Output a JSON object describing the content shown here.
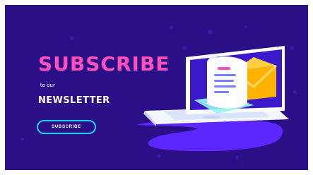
{
  "banner": {
    "title": "SUBSCRIBE",
    "subtitle": "to our",
    "heading2": "NEWSLETTER",
    "cta_label": "SUBSCRIBE",
    "colors": {
      "background": "#2a0f86",
      "title_pink": "#ff4fb8",
      "cta_cyan": "#24d3ff",
      "laptop_screen": "#3b18c9",
      "shadow": "#5b26ff",
      "envelope": "#ffb200"
    }
  }
}
